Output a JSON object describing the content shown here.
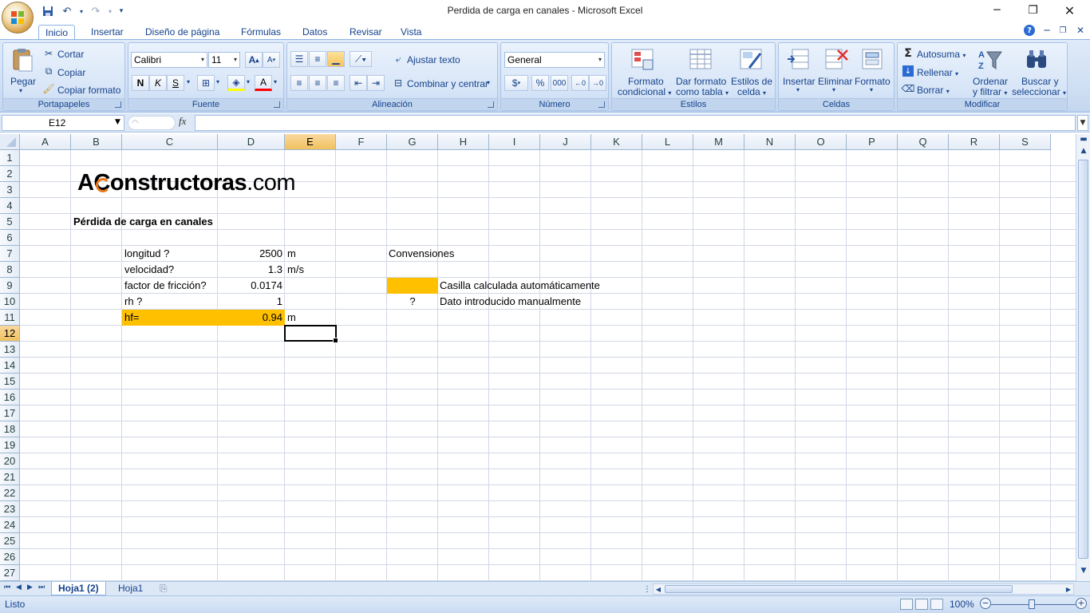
{
  "window": {
    "title": "Perdida de carga en canales - Microsoft Excel"
  },
  "ribbon_tabs": [
    "Inicio",
    "Insertar",
    "Diseño de página",
    "Fórmulas",
    "Datos",
    "Revisar",
    "Vista"
  ],
  "ribbon": {
    "portapapeles": {
      "label": "Portapapeles",
      "paste": "Pegar",
      "cut": "Cortar",
      "copy": "Copiar",
      "format_painter": "Copiar formato"
    },
    "fuente": {
      "label": "Fuente",
      "font_name": "Calibri",
      "font_size": "11",
      "bold": "N",
      "italic": "K",
      "underline": "S"
    },
    "alineacion": {
      "label": "Alineación",
      "wrap": "Ajustar texto",
      "merge": "Combinar y centrar"
    },
    "numero": {
      "label": "Número",
      "format": "General",
      "currency": "$",
      "percent": "%",
      "thousands": "000"
    },
    "estilos": {
      "label": "Estilos",
      "cond_format_1": "Formato",
      "cond_format_2": "condicional",
      "table_format_1": "Dar formato",
      "table_format_2": "como tabla",
      "cell_styles_1": "Estilos de",
      "cell_styles_2": "celda"
    },
    "celdas": {
      "label": "Celdas",
      "insert": "Insertar",
      "delete": "Eliminar",
      "format": "Formato"
    },
    "modificar": {
      "label": "Modificar",
      "autosum": "Autosuma",
      "fill": "Rellenar",
      "clear": "Borrar",
      "sort_1": "Ordenar",
      "sort_2": "y filtrar",
      "find_1": "Buscar y",
      "find_2": "seleccionar"
    }
  },
  "formula_bar": {
    "name_box": "E12",
    "fx": "fx",
    "formula": ""
  },
  "columns": [
    "A",
    "B",
    "C",
    "D",
    "E",
    "F",
    "G",
    "H",
    "I",
    "J",
    "K",
    "L",
    "M",
    "N",
    "O",
    "P",
    "Q",
    "R",
    "S"
  ],
  "rows": [
    "1",
    "2",
    "3",
    "4",
    "5",
    "6",
    "7",
    "8",
    "9",
    "10",
    "11",
    "12",
    "13",
    "14",
    "15",
    "16",
    "17",
    "18",
    "19",
    "20",
    "21",
    "22",
    "23",
    "24",
    "25",
    "26",
    "27"
  ],
  "sheet": {
    "logo_a": "A",
    "logo_c": "C",
    "logo_rest": "onstructoras",
    "logo_dom": ".com",
    "title": "Pérdida de carga en canales",
    "c7": "longitud ?",
    "d7": "2500",
    "e7": "m",
    "c8": "velocidad?",
    "d8": "1.3",
    "e8": "m/s",
    "c9": "factor de fricción?",
    "d9": "0.0174",
    "c10": "rh ?",
    "d10": "1",
    "c11": "hf=",
    "d11": "0.94",
    "e11": "m",
    "g7": "Convensiones",
    "h9": "Casilla calculada automáticamente",
    "g10": "?",
    "h10": "Dato introducido manualmente"
  },
  "sheet_tabs": [
    "Hoja1 (2)",
    "Hoja1"
  ],
  "status": {
    "text": "Listo",
    "zoom": "100%"
  },
  "colors": {
    "calculated": "#ffc000",
    "accent": "#15428b"
  }
}
